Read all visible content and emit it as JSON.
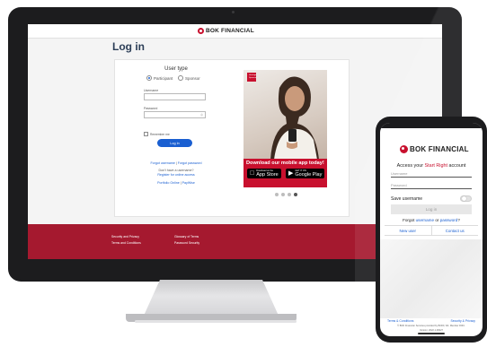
{
  "brand": {
    "name": "BOK FINANCIAL",
    "red": "#c8102e",
    "blue": "#1a5fd1"
  },
  "desktop": {
    "page_title": "Log in",
    "user_type": {
      "heading": "User type",
      "options": [
        "Participant",
        "Sponsor"
      ],
      "selected": "Participant"
    },
    "username_label": "Username",
    "username_value": "",
    "password_label": "Password",
    "password_value": "",
    "password_toggle": "eye-icon",
    "remember_label": "Remember me",
    "remember_checked": false,
    "login_button": "Log In",
    "links": {
      "forgot_username": "Forgot username",
      "separator": "|",
      "forgot_password": "Forgot password",
      "no_username": "Don't have a username?",
      "register": "Register for online access",
      "portfolio_online": "Portfolio Online",
      "paywise": "PayWise"
    },
    "promo": {
      "logo_text": "Heritage Sponsor",
      "headline": "Download our mobile app today!",
      "app_store": {
        "small": "Download on the",
        "big": "App Store",
        "icon": "apple-icon"
      },
      "google_play": {
        "small": "GET IT ON",
        "big": "Google Play",
        "icon": "play-icon"
      },
      "carousel_dots": 4,
      "carousel_active": 4
    },
    "footer": {
      "security": "Security and Privacy",
      "glossary": "Glossary of Terms",
      "terms": "Terms and Conditions",
      "password_security": "Password Security"
    }
  },
  "mobile": {
    "access_prefix": "Access your ",
    "access_accent": "Start Right",
    "access_suffix": " account",
    "username_placeholder": "Username",
    "password_placeholder": "Password",
    "save_username": "Save username",
    "save_username_on": false,
    "login_button": "Log in",
    "forgot_prefix": "Forgot ",
    "forgot_username": "username",
    "forgot_or": " or ",
    "forgot_password": "password",
    "forgot_suffix": "?",
    "new_user": "New user",
    "contact_us": "Contact us",
    "terms": "Terms & Conditions",
    "security": "Security & Privacy",
    "copyright": "© BOK Financial. Services provided by BOKF, NA. Member FDIC.",
    "version": "Version: 2022.1.48227"
  }
}
